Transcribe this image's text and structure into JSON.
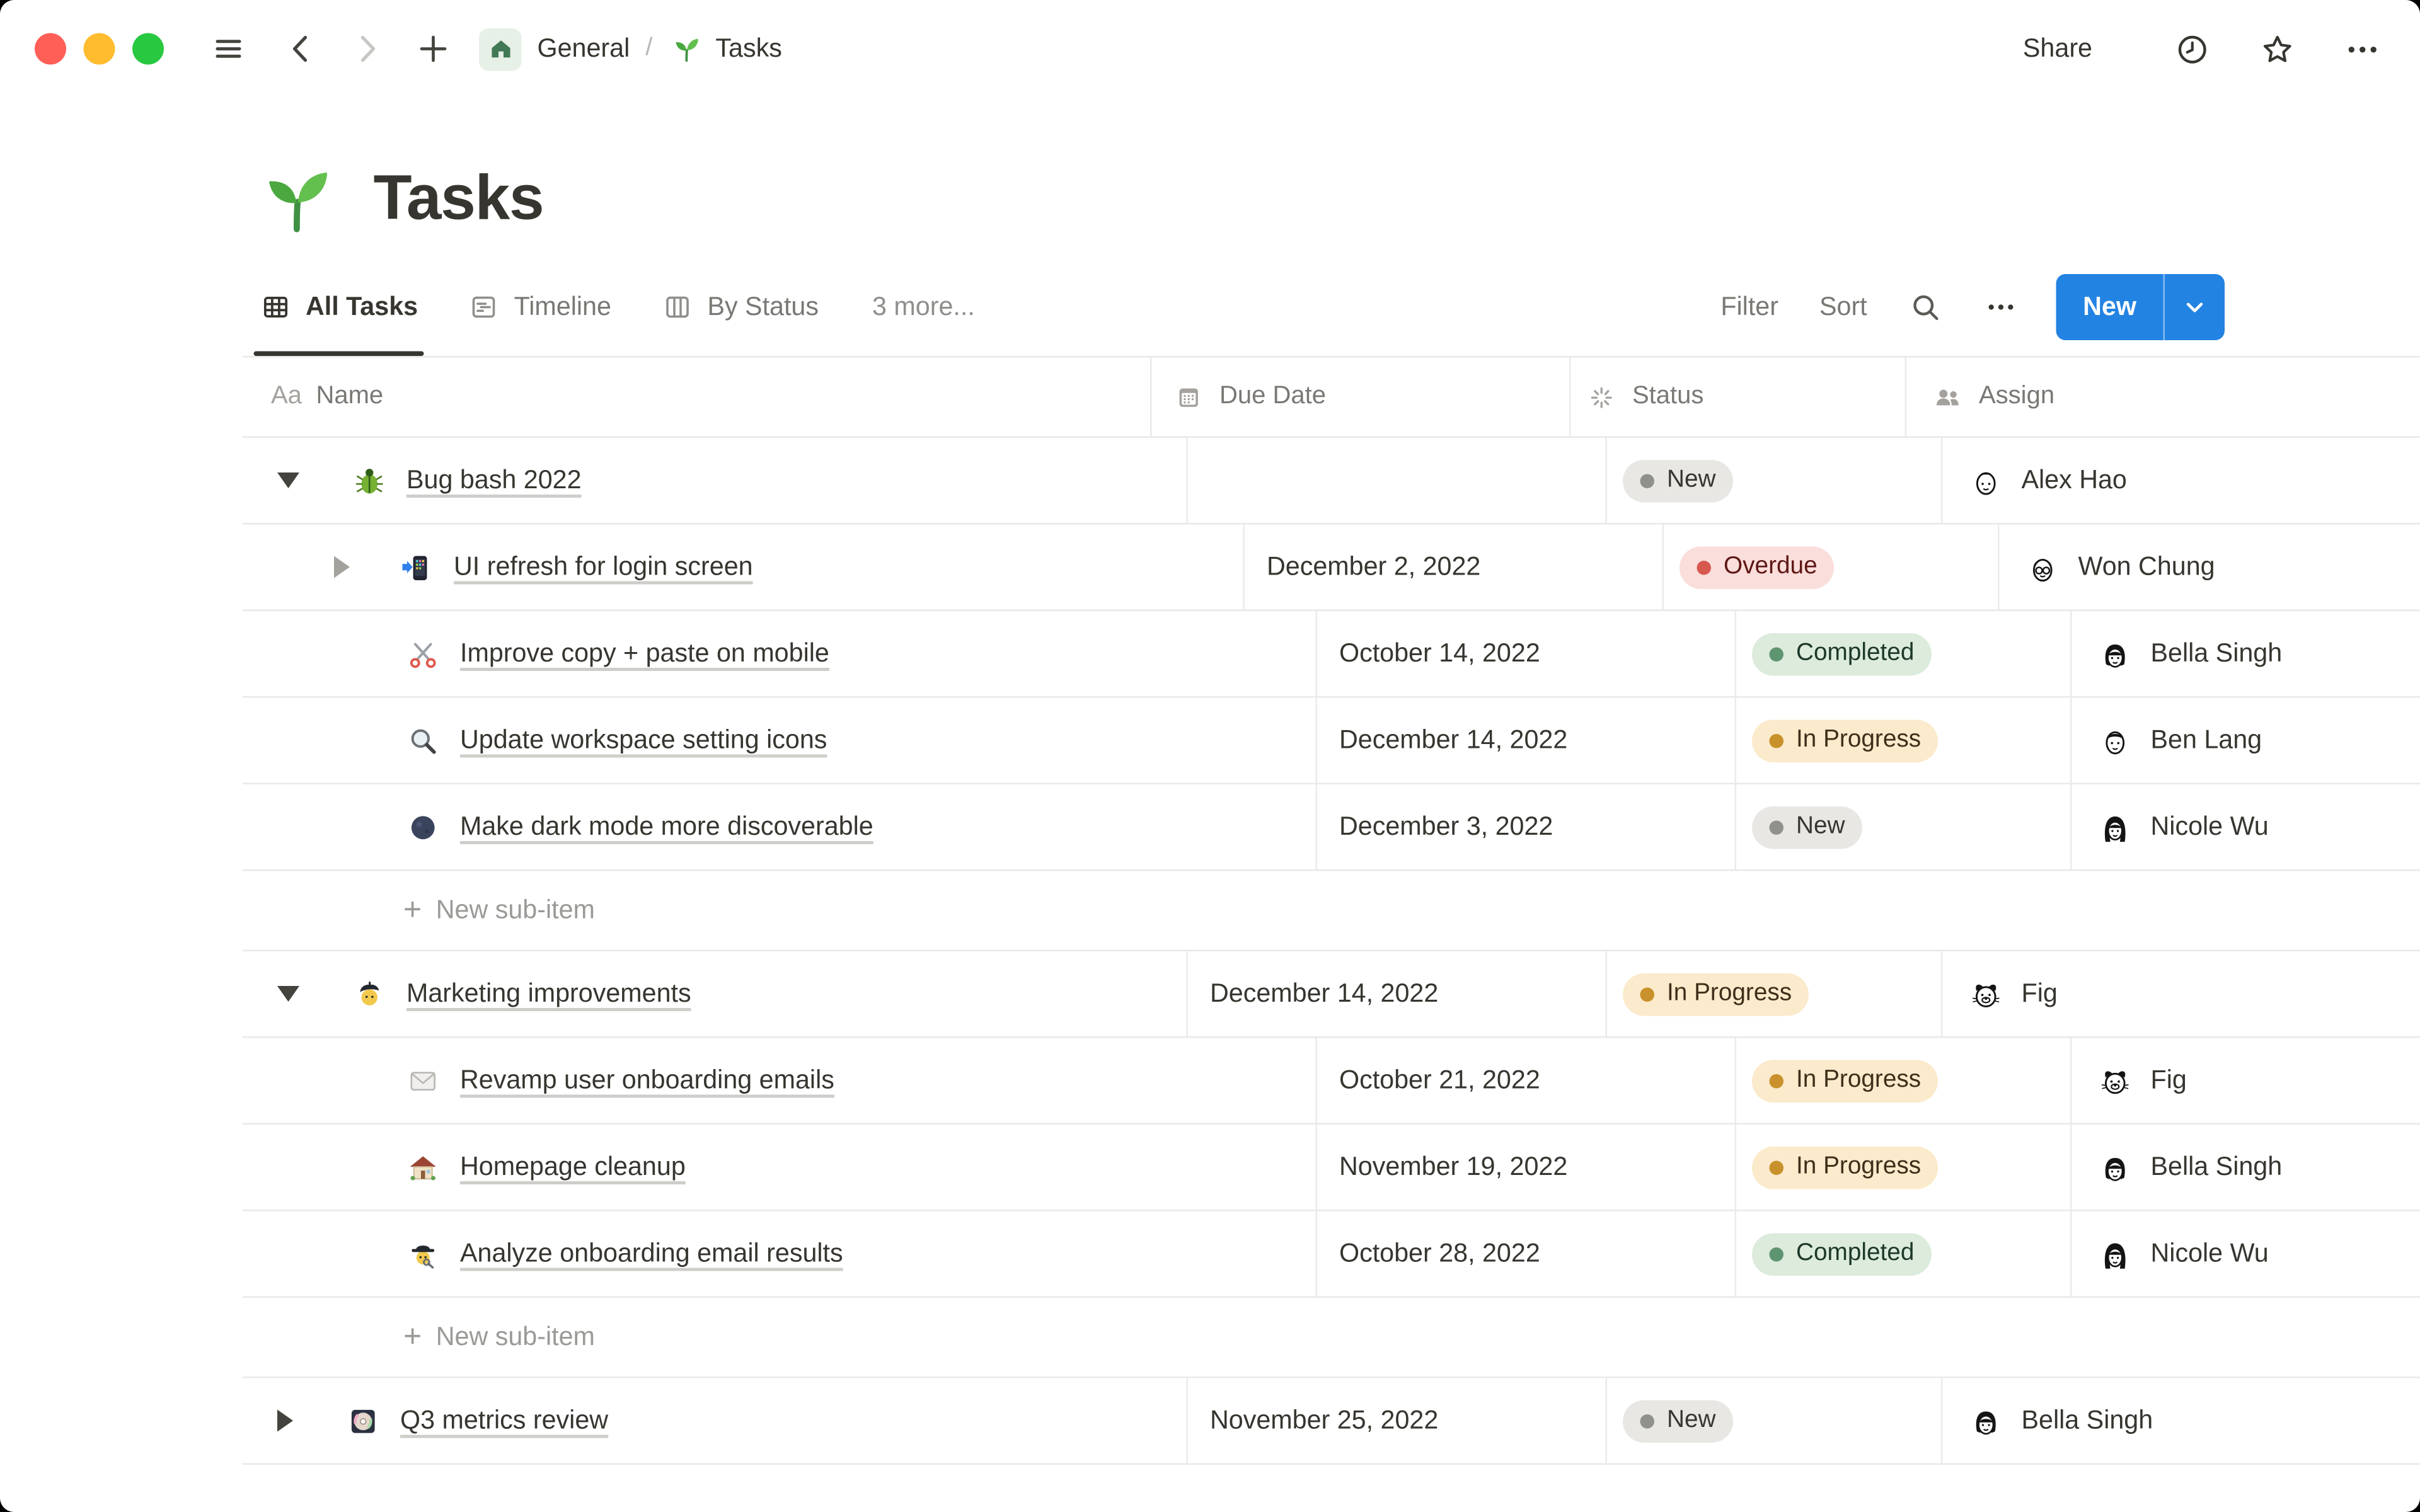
{
  "window": {
    "traffic_lights": {
      "close": "#FF5F57",
      "minimize": "#FEBC2E",
      "zoom": "#28C840"
    }
  },
  "toolbar": {
    "breadcrumb": {
      "root": "General",
      "page": "Tasks"
    },
    "share_label": "Share"
  },
  "page": {
    "icon": "seedling",
    "title": "Tasks"
  },
  "views": {
    "tabs": [
      {
        "label": "All Tasks",
        "icon": "table",
        "active": true
      },
      {
        "label": "Timeline",
        "icon": "timeline",
        "active": false
      },
      {
        "label": "By Status",
        "icon": "board",
        "active": false
      }
    ],
    "more_label": "3 more...",
    "filter_label": "Filter",
    "sort_label": "Sort",
    "new_button": {
      "label": "New",
      "color": "#2383E2"
    }
  },
  "table": {
    "columns": [
      {
        "label": "Name",
        "type_badge": "Aa"
      },
      {
        "label": "Due Date",
        "icon": "calendar"
      },
      {
        "label": "Status",
        "icon": "status-spinner"
      },
      {
        "label": "Assign",
        "icon": "people"
      }
    ],
    "new_subitem_label": "New sub-item",
    "rows": [
      {
        "type": "task",
        "level": 0,
        "toggle": "expanded",
        "icon": "beetle",
        "name": "Bug bash 2022",
        "date": "",
        "status": {
          "label": "New",
          "color": "gray"
        },
        "assignee": {
          "name": "Alex Hao",
          "avatar": "man-short-hair"
        }
      },
      {
        "type": "task",
        "level": 1,
        "toggle": "collapsed",
        "icon": "phone-arrow",
        "name": "UI refresh for login screen",
        "date": "December 2, 2022",
        "status": {
          "label": "Overdue",
          "color": "red"
        },
        "assignee": {
          "name": "Won Chung",
          "avatar": "man-glasses"
        }
      },
      {
        "type": "task",
        "level": 1,
        "toggle": null,
        "icon": "scissors",
        "name": "Improve copy + paste on mobile",
        "date": "October 14, 2022",
        "status": {
          "label": "Completed",
          "color": "green"
        },
        "assignee": {
          "name": "Bella Singh",
          "avatar": "woman-bob"
        }
      },
      {
        "type": "task",
        "level": 1,
        "toggle": null,
        "icon": "magnifier",
        "name": "Update workspace setting icons",
        "date": "December 14, 2022",
        "status": {
          "label": "In Progress",
          "color": "yellow"
        },
        "assignee": {
          "name": "Ben Lang",
          "avatar": "man-crop"
        }
      },
      {
        "type": "task",
        "level": 1,
        "toggle": null,
        "icon": "new-moon",
        "name": "Make dark mode more discoverable",
        "date": "December 3, 2022",
        "status": {
          "label": "New",
          "color": "gray"
        },
        "assignee": {
          "name": "Nicole Wu",
          "avatar": "woman-long-hair"
        }
      },
      {
        "type": "new_sub_item",
        "label": "New sub-item"
      },
      {
        "type": "task",
        "level": 0,
        "toggle": "expanded",
        "icon": "artist",
        "name": "Marketing improvements",
        "date": "December 14, 2022",
        "status": {
          "label": "In Progress",
          "color": "yellow"
        },
        "assignee": {
          "name": "Fig",
          "avatar": "dog"
        }
      },
      {
        "type": "task",
        "level": 1,
        "toggle": null,
        "icon": "envelope",
        "name": "Revamp user onboarding emails",
        "date": "October 21, 2022",
        "status": {
          "label": "In Progress",
          "color": "yellow"
        },
        "assignee": {
          "name": "Fig",
          "avatar": "dog"
        }
      },
      {
        "type": "task",
        "level": 1,
        "toggle": null,
        "icon": "house",
        "name": "Homepage cleanup",
        "date": "November 19, 2022",
        "status": {
          "label": "In Progress",
          "color": "yellow"
        },
        "assignee": {
          "name": "Bella Singh",
          "avatar": "woman-bob"
        }
      },
      {
        "type": "task",
        "level": 1,
        "toggle": null,
        "icon": "detective",
        "name": "Analyze onboarding email results",
        "date": "October 28, 2022",
        "status": {
          "label": "Completed",
          "color": "green"
        },
        "assignee": {
          "name": "Nicole Wu",
          "avatar": "woman-long-hair"
        }
      },
      {
        "type": "new_sub_item",
        "label": "New sub-item"
      },
      {
        "type": "task",
        "level": 0,
        "toggle": "collapsed",
        "icon": "minidisc",
        "name": "Q3 metrics review",
        "date": "November 25, 2022",
        "status": {
          "label": "New",
          "color": "gray"
        },
        "assignee": {
          "name": "Bella Singh",
          "avatar": "woman-bob"
        }
      }
    ]
  },
  "theme": {
    "accent_blue": "#2383E2",
    "text_primary": "#37352F",
    "text_secondary": "#7A7874",
    "border": "#E9E9E7",
    "status_colors": {
      "gray": {
        "bg": "#E8E7E4",
        "dot": "#90908C",
        "text": "#373530"
      },
      "red": {
        "bg": "#FADEDB",
        "dot": "#D6584E",
        "text": "#5D1715"
      },
      "green": {
        "bg": "#DCEBDC",
        "dot": "#5F9471",
        "text": "#1C3829"
      },
      "yellow": {
        "bg": "#FBEACB",
        "dot": "#C9912B",
        "text": "#3F2E1A"
      }
    }
  }
}
